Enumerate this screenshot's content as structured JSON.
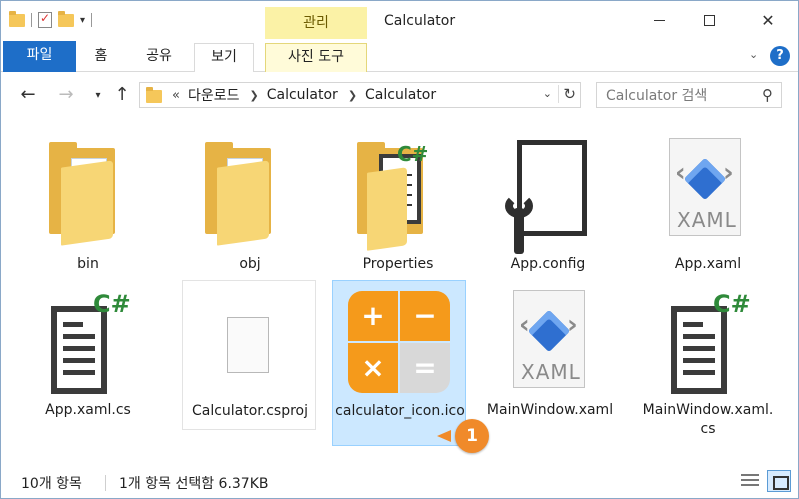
{
  "window": {
    "title": "Calculator",
    "context_tab_group": "관리"
  },
  "ribbon": {
    "tabs": [
      {
        "label": "파일"
      },
      {
        "label": "홈"
      },
      {
        "label": "공유"
      },
      {
        "label": "보기"
      },
      {
        "label": "사진 도구"
      }
    ],
    "help": "?"
  },
  "address": {
    "overflow": "«",
    "crumbs": [
      "다운로드",
      "Calculator",
      "Calculator"
    ]
  },
  "search": {
    "placeholder": "Calculator 검색"
  },
  "files": [
    {
      "name": "bin",
      "icon": "folder-icon"
    },
    {
      "name": "obj",
      "icon": "folder-icon"
    },
    {
      "name": "Properties",
      "icon": "csharp-folder-icon",
      "badge": "C#"
    },
    {
      "name": "App.config",
      "icon": "config-file-icon"
    },
    {
      "name": "App.xaml",
      "icon": "xaml-file-icon",
      "badge": "XAML"
    },
    {
      "name": "App.xaml.cs",
      "icon": "csharp-file-icon",
      "badge": "C#"
    },
    {
      "name": "Calculator.csproj",
      "icon": "blank-file-icon"
    },
    {
      "name": "calculator_icon.ico",
      "icon": "calculator-icon",
      "selected": true,
      "glyphs": [
        "+",
        "−",
        "×",
        "="
      ]
    },
    {
      "name": "MainWindow.xaml",
      "icon": "xaml-file-icon",
      "badge": "XAML"
    },
    {
      "name": "MainWindow.xaml.cs",
      "icon": "csharp-file-icon",
      "badge": "C#"
    }
  ],
  "annotation": {
    "label": "1"
  },
  "status": {
    "item_count": "10개 항목",
    "selection": "1개 항목 선택함 6.37KB"
  },
  "colors": {
    "file_tab": "#1e6ec8",
    "context_tab": "#fbf2a6",
    "selection": "#cce8ff",
    "calc_orange": "#f59a1b",
    "calc_gray": "#d8d8d8",
    "csharp_green": "#2f8a3a",
    "annotation": "#f08a2a"
  }
}
